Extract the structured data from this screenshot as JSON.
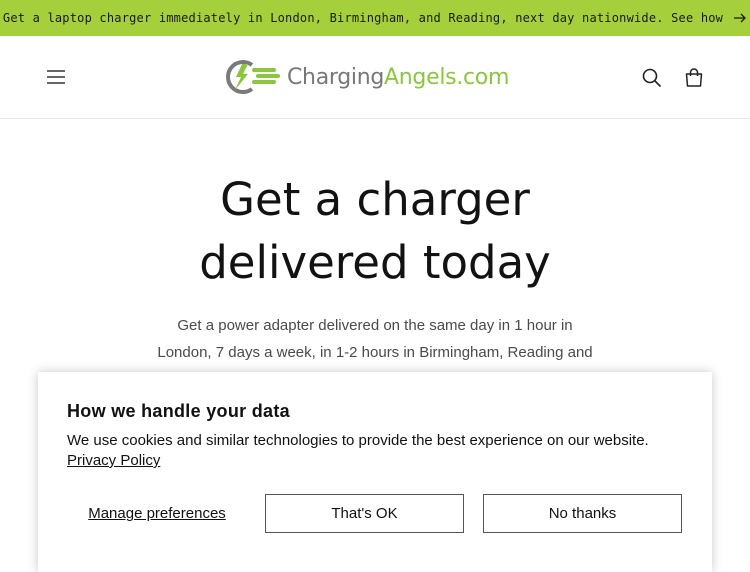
{
  "announcement": {
    "text": "Get a laptop charger immediately in London, Birmingham, and Reading, next day nationwide. See how",
    "icon": "arrow-right-icon",
    "background": "#a6cf3c"
  },
  "header": {
    "menu_icon": "hamburger-menu-icon",
    "logo": {
      "text_part1": "Charging",
      "text_part2": "Angels.com",
      "color_part1": "#777777",
      "color_part2": "#8cc63f"
    },
    "search_icon": "search-icon",
    "cart_icon": "cart-icon"
  },
  "hero": {
    "title_line1": "Get a charger",
    "title_line2": "delivered today",
    "subtitle_line1": "Get a power adapter delivered on the same day in 1 hour in",
    "subtitle_line2": "London, 7 days a week, in 1-2 hours in Birmingham, Reading and"
  },
  "cookie_banner": {
    "title": "How we handle your data",
    "body": "We use cookies and similar technologies to provide the best experience on our website.",
    "privacy_link": "Privacy Policy",
    "manage_label": "Manage preferences",
    "accept_label": "That's OK",
    "decline_label": "No thanks"
  }
}
